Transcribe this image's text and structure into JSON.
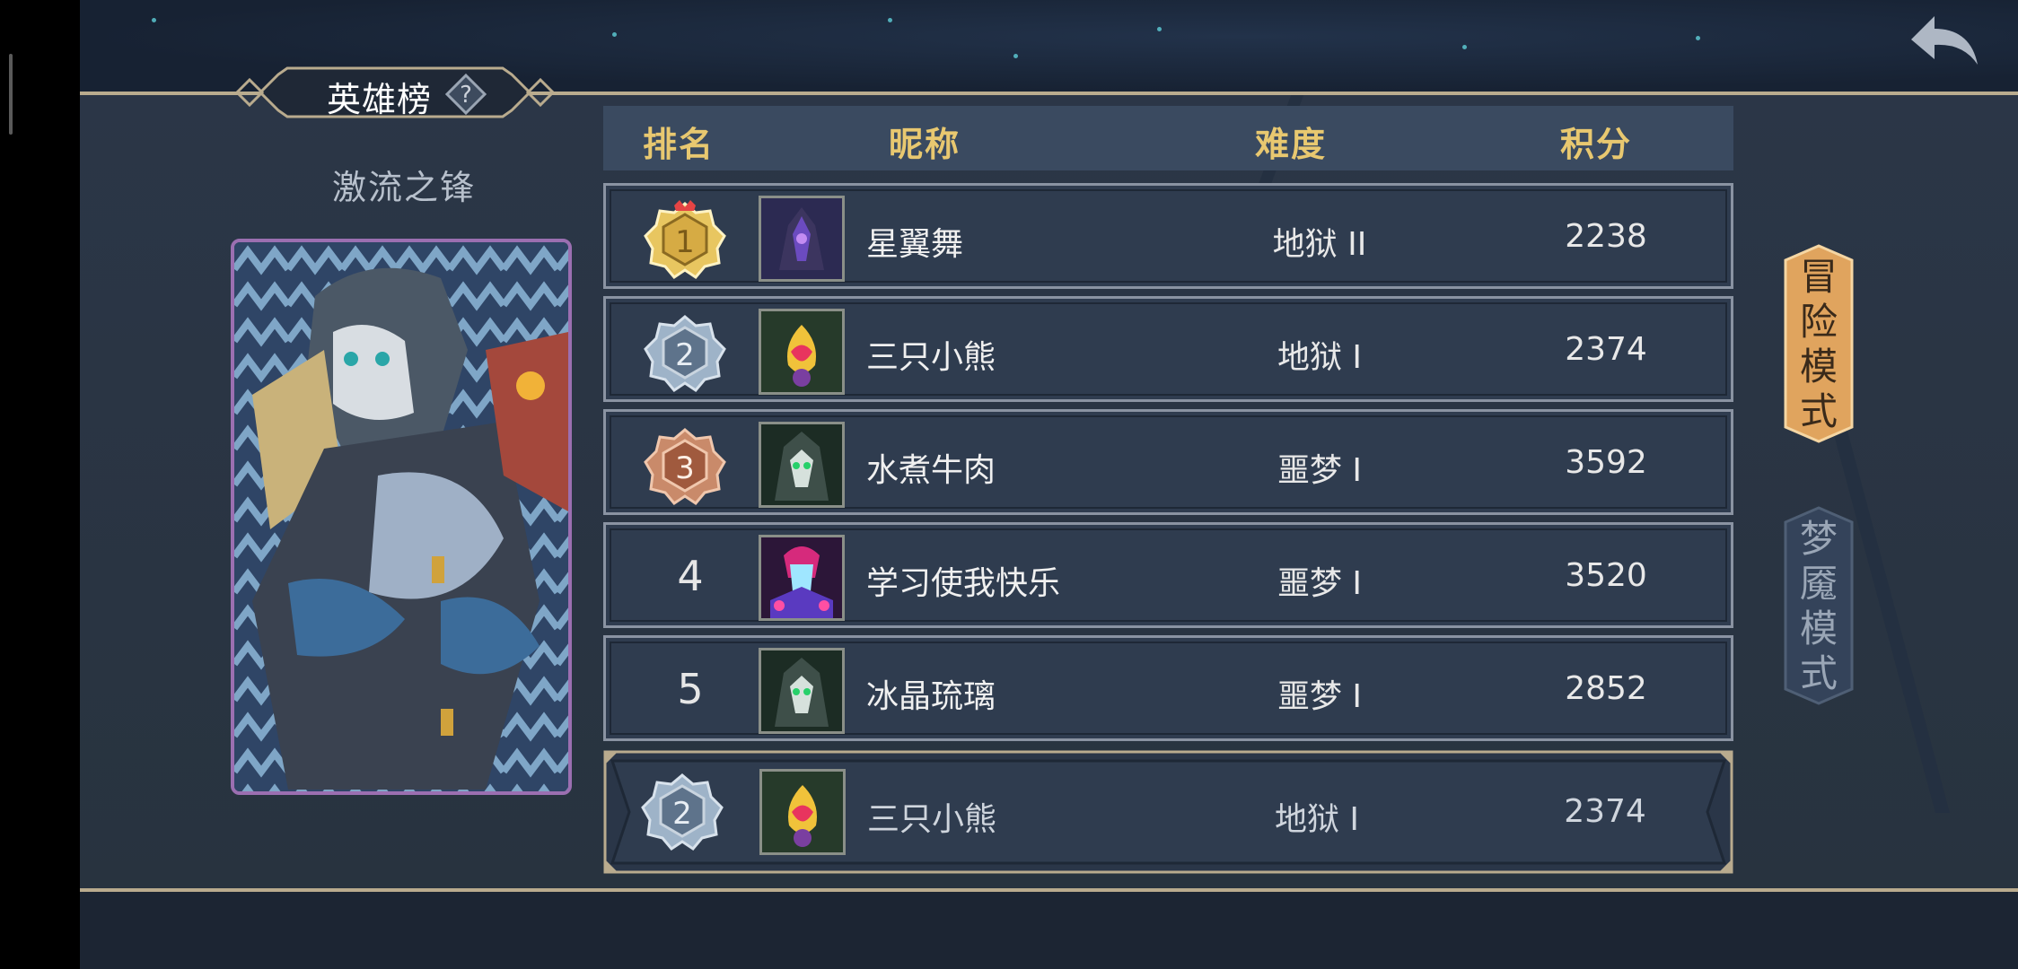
{
  "leaderboard": {
    "title": "英雄榜",
    "help_icon": "question-icon",
    "hero_name": "激流之锋"
  },
  "table": {
    "headers": {
      "rank": "排名",
      "nickname": "昵称",
      "difficulty": "难度",
      "score": "积分"
    },
    "rows": [
      {
        "rank": "1",
        "nickname": "星翼舞",
        "difficulty": "地狱 II",
        "score": "2238",
        "medal": "gold"
      },
      {
        "rank": "2",
        "nickname": "三只小熊",
        "difficulty": "地狱 I",
        "score": "2374",
        "medal": "silver"
      },
      {
        "rank": "3",
        "nickname": "水煮牛肉",
        "difficulty": "噩梦 I",
        "score": "3592",
        "medal": "bronze"
      },
      {
        "rank": "4",
        "nickname": "学习使我快乐",
        "difficulty": "噩梦 I",
        "score": "3520",
        "medal": ""
      },
      {
        "rank": "5",
        "nickname": "冰晶琉璃",
        "difficulty": "噩梦 I",
        "score": "2852",
        "medal": ""
      }
    ],
    "self": {
      "rank": "2",
      "nickname": "三只小熊",
      "difficulty": "地狱 I",
      "score": "2374",
      "medal": "silver"
    }
  },
  "modes": {
    "adventure": "冒险模式",
    "nightmare": "梦魇模式"
  },
  "colors": {
    "accent_gold": "#e8c870",
    "frame": "#b9ab8e",
    "active_mode": "#e0a45e",
    "hero_card_border": "#9b6fb1"
  },
  "icons": {
    "back": "back-arrow-icon"
  }
}
